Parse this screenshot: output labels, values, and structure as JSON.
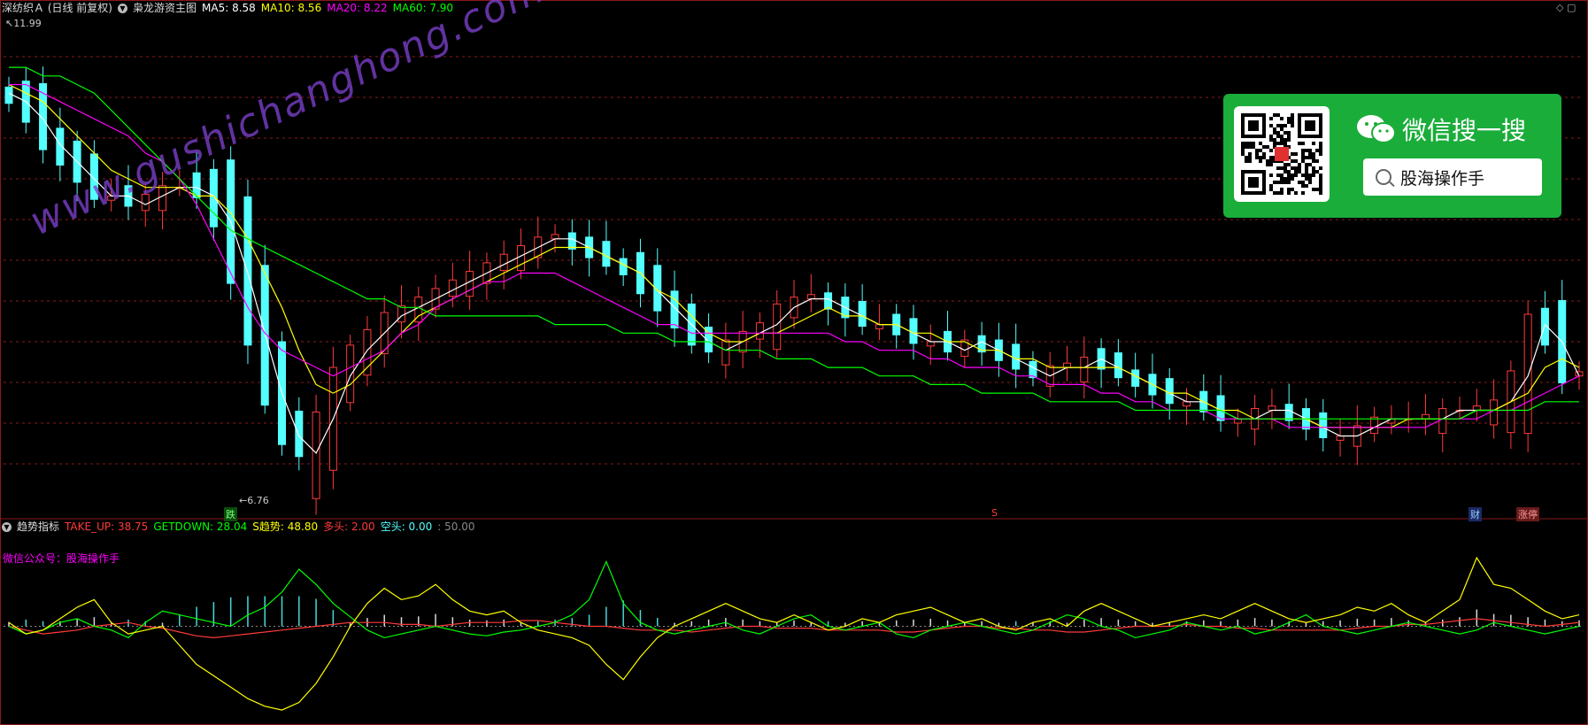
{
  "main_header": {
    "stock": "深纺织Ａ (日线 前复权)",
    "indicator_name": "枭龙游资主图",
    "ma5": "MA5: 8.58",
    "ma10": "MA10: 8.56",
    "ma20": "MA20: 8.22",
    "ma60": "MA60: 7.90"
  },
  "sub_header": {
    "name": "趋势指标",
    "take_up": "TAKE_UP: 38.75",
    "getdown": "GETDOWN: 28.04",
    "s_trend": "S趋势: 48.80",
    "duotou": "多头: 2.00",
    "kongtou": "空头: 0.00",
    "level": ": 50.00"
  },
  "sub_note": "微信公众号：股海操作手",
  "price_labels": {
    "high": "11.99",
    "low": "6.76"
  },
  "tags": {
    "die": "跌",
    "s": "S",
    "cai": "财",
    "zhangting": "涨停"
  },
  "watermark": "www.gushichanghong.com",
  "wechat": {
    "title": "微信搜一搜",
    "search_text": "股海操作手"
  },
  "icons": {
    "collapse": "chevron-down-icon",
    "search": "search-icon",
    "wechat": "wechat-logo-icon",
    "qr": "qr-code-icon"
  },
  "colors": {
    "up": "#ff3a3a",
    "down": "#54ffff",
    "ma5": "#ffffff",
    "ma10": "#ffff00",
    "ma20": "#ff00ff",
    "ma60": "#00ff00",
    "grid": "#8b1a1a"
  },
  "chart_data": [
    {
      "type": "candlestick",
      "title": "枭龙游资主图",
      "price_range": [
        6.5,
        12.2
      ],
      "annotations": {
        "high": 11.99,
        "low": 6.76
      },
      "series": [
        {
          "name": "MA5",
          "values": [
            11.3,
            11.2,
            11.0,
            10.7,
            10.5,
            10.3,
            10.1,
            10.1,
            10.0,
            10.1,
            10.2,
            10.2,
            10.1,
            9.8,
            9.2,
            8.5,
            7.8,
            7.3,
            7.1,
            7.5,
            8.0,
            8.3,
            8.5,
            8.7,
            8.8,
            8.9,
            9.0,
            9.1,
            9.2,
            9.3,
            9.4,
            9.5,
            9.6,
            9.6,
            9.5,
            9.4,
            9.3,
            9.2,
            9.0,
            8.8,
            8.6,
            8.4,
            8.3,
            8.4,
            8.5,
            8.6,
            8.8,
            8.9,
            8.9,
            8.8,
            8.7,
            8.6,
            8.6,
            8.5,
            8.4,
            8.4,
            8.3,
            8.4,
            8.3,
            8.2,
            8.1,
            8.0,
            8.1,
            8.1,
            8.2,
            8.1,
            8.0,
            7.9,
            7.8,
            7.7,
            7.7,
            7.6,
            7.5,
            7.5,
            7.6,
            7.6,
            7.5,
            7.4,
            7.3,
            7.3,
            7.4,
            7.5,
            7.5,
            7.5,
            7.5,
            7.6,
            7.6,
            7.6,
            7.7,
            8.0,
            8.6,
            8.4,
            8.0
          ]
        },
        {
          "name": "MA10",
          "values": [
            11.4,
            11.3,
            11.2,
            11.0,
            10.8,
            10.6,
            10.4,
            10.3,
            10.2,
            10.2,
            10.2,
            10.1,
            10.1,
            9.9,
            9.6,
            9.2,
            8.8,
            8.3,
            7.9,
            7.8,
            7.9,
            8.1,
            8.3,
            8.5,
            8.7,
            8.8,
            8.9,
            9.0,
            9.1,
            9.2,
            9.3,
            9.4,
            9.5,
            9.5,
            9.5,
            9.4,
            9.3,
            9.2,
            9.0,
            8.9,
            8.7,
            8.5,
            8.4,
            8.4,
            8.5,
            8.5,
            8.6,
            8.7,
            8.8,
            8.7,
            8.7,
            8.6,
            8.6,
            8.5,
            8.5,
            8.4,
            8.4,
            8.3,
            8.3,
            8.2,
            8.2,
            8.1,
            8.1,
            8.1,
            8.1,
            8.1,
            8.0,
            7.9,
            7.8,
            7.8,
            7.7,
            7.6,
            7.6,
            7.5,
            7.5,
            7.5,
            7.5,
            7.4,
            7.4,
            7.4,
            7.4,
            7.4,
            7.5,
            7.5,
            7.5,
            7.5,
            7.6,
            7.6,
            7.7,
            7.8,
            8.1,
            8.2,
            8.1
          ]
        },
        {
          "name": "MA20",
          "values": [
            11.4,
            11.4,
            11.3,
            11.2,
            11.1,
            11.0,
            10.9,
            10.8,
            10.6,
            10.5,
            10.3,
            10.0,
            9.6,
            9.2,
            8.8,
            8.5,
            8.3,
            8.2,
            8.1,
            8.0,
            8.1,
            8.2,
            8.3,
            8.5,
            8.6,
            8.8,
            8.9,
            9.0,
            9.1,
            9.1,
            9.2,
            9.2,
            9.2,
            9.1,
            9.0,
            8.9,
            8.8,
            8.7,
            8.6,
            8.6,
            8.5,
            8.5,
            8.5,
            8.5,
            8.5,
            8.5,
            8.5,
            8.5,
            8.5,
            8.4,
            8.4,
            8.3,
            8.3,
            8.3,
            8.2,
            8.2,
            8.1,
            8.1,
            8.1,
            8.0,
            8.0,
            7.9,
            7.9,
            7.9,
            7.8,
            7.8,
            7.7,
            7.7,
            7.6,
            7.6,
            7.6,
            7.5,
            7.5,
            7.5,
            7.5,
            7.4,
            7.4,
            7.4,
            7.4,
            7.4,
            7.4,
            7.4,
            7.4,
            7.4,
            7.5,
            7.5,
            7.5,
            7.6,
            7.6,
            7.7,
            7.8,
            7.9,
            8.0
          ]
        },
        {
          "name": "MA60",
          "values": [
            11.6,
            11.6,
            11.5,
            11.5,
            11.4,
            11.3,
            11.1,
            10.9,
            10.7,
            10.5,
            10.3,
            10.1,
            9.9,
            9.7,
            9.6,
            9.5,
            9.4,
            9.3,
            9.2,
            9.1,
            9.0,
            8.9,
            8.9,
            8.8,
            8.8,
            8.7,
            8.7,
            8.7,
            8.7,
            8.7,
            8.7,
            8.7,
            8.6,
            8.6,
            8.6,
            8.6,
            8.5,
            8.5,
            8.5,
            8.4,
            8.4,
            8.4,
            8.3,
            8.3,
            8.3,
            8.2,
            8.2,
            8.2,
            8.1,
            8.1,
            8.1,
            8.0,
            8.0,
            8.0,
            7.9,
            7.9,
            7.9,
            7.8,
            7.8,
            7.8,
            7.8,
            7.7,
            7.7,
            7.7,
            7.7,
            7.7,
            7.6,
            7.6,
            7.6,
            7.6,
            7.6,
            7.6,
            7.5,
            7.5,
            7.5,
            7.5,
            7.5,
            7.5,
            7.5,
            7.5,
            7.5,
            7.5,
            7.5,
            7.5,
            7.5,
            7.5,
            7.6,
            7.6,
            7.6,
            7.6,
            7.7,
            7.7,
            7.7
          ]
        }
      ]
    },
    {
      "type": "line",
      "title": "趋势指标",
      "y_range": [
        0,
        100
      ],
      "level": 50,
      "series": [
        {
          "name": "TAKE_UP",
          "values": [
            50,
            48,
            46,
            47,
            48,
            50,
            51,
            52,
            50,
            49,
            47,
            45,
            44,
            45,
            46,
            47,
            48,
            49,
            50,
            51,
            52,
            52,
            52,
            51,
            51,
            50,
            51,
            52,
            52,
            52,
            53,
            53,
            52,
            51,
            50,
            50,
            49,
            48,
            48,
            48,
            47,
            48,
            49,
            50,
            50,
            49,
            49,
            49,
            48,
            48,
            48,
            48,
            47,
            47,
            48,
            49,
            50,
            50,
            49,
            49,
            48,
            48,
            47,
            47,
            48,
            49,
            50,
            50,
            50,
            51,
            50,
            50,
            49,
            49,
            48,
            48,
            48,
            48,
            48,
            49,
            50,
            50,
            51,
            51,
            52,
            53,
            54,
            53,
            52,
            51,
            50,
            51,
            52
          ]
        },
        {
          "name": "GETDOWN",
          "values": [
            50,
            46,
            48,
            52,
            54,
            50,
            48,
            44,
            52,
            58,
            56,
            54,
            52,
            50,
            56,
            60,
            68,
            80,
            72,
            62,
            55,
            48,
            44,
            46,
            48,
            50,
            48,
            46,
            45,
            47,
            48,
            50,
            52,
            56,
            64,
            84,
            62,
            52,
            48,
            46,
            48,
            50,
            52,
            48,
            46,
            50,
            54,
            56,
            50,
            48,
            50,
            52,
            46,
            44,
            48,
            50,
            52,
            50,
            48,
            46,
            48,
            52,
            56,
            54,
            50,
            48,
            44,
            46,
            48,
            52,
            50,
            48,
            50,
            46,
            48,
            52,
            56,
            50,
            48,
            46,
            48,
            50,
            52,
            50,
            48,
            46,
            48,
            52,
            50,
            48,
            46,
            48,
            50
          ]
        },
        {
          "name": "S趋势",
          "values": [
            52,
            46,
            48,
            54,
            60,
            64,
            52,
            46,
            48,
            50,
            40,
            30,
            24,
            18,
            12,
            8,
            6,
            10,
            20,
            34,
            50,
            62,
            70,
            64,
            66,
            72,
            64,
            58,
            56,
            58,
            52,
            48,
            46,
            44,
            40,
            30,
            22,
            34,
            44,
            50,
            54,
            58,
            62,
            58,
            54,
            52,
            56,
            52,
            48,
            50,
            54,
            52,
            56,
            58,
            60,
            56,
            52,
            54,
            50,
            48,
            52,
            54,
            50,
            58,
            62,
            58,
            54,
            50,
            52,
            54,
            56,
            54,
            58,
            62,
            58,
            54,
            52,
            54,
            56,
            60,
            58,
            62,
            56,
            52,
            58,
            64,
            86,
            72,
            70,
            64,
            58,
            54,
            56
          ]
        }
      ]
    }
  ]
}
